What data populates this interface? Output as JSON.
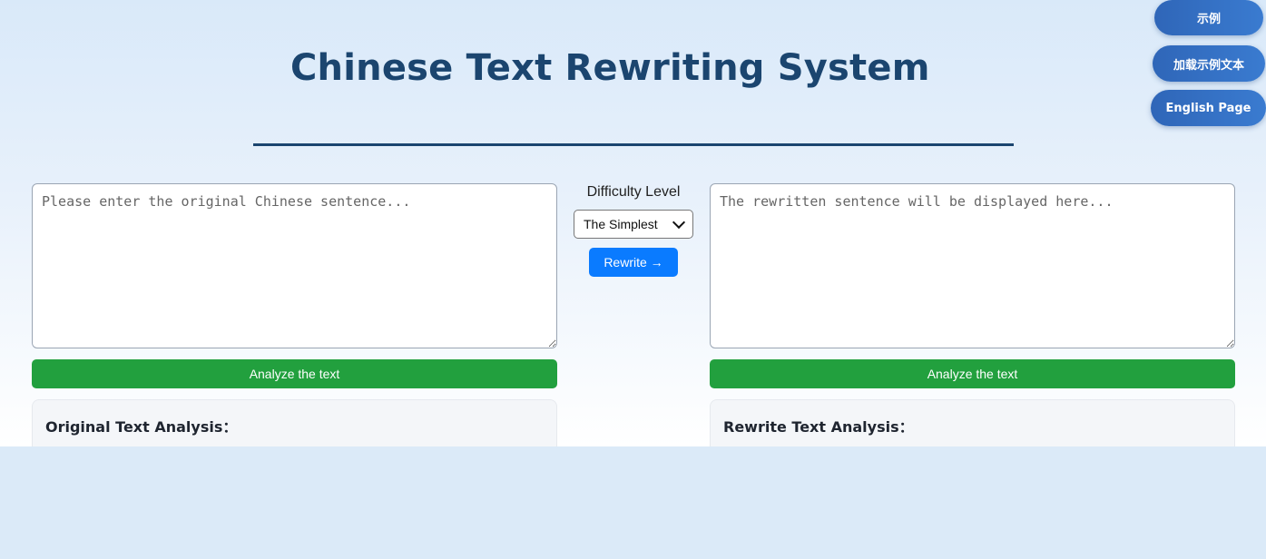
{
  "header": {
    "title": "Chinese Text Rewriting System"
  },
  "corner_buttons": {
    "example": "示例",
    "load_example": "加载示例文本",
    "english_page": "English Page"
  },
  "original": {
    "placeholder": "Please enter the original Chinese sentence...",
    "analyze_label": "Analyze the text",
    "analysis_title": "Original Text Analysis："
  },
  "controls": {
    "difficulty_label": "Difficulty Level",
    "difficulty_selected": "The Simplest",
    "rewrite_label": "Rewrite →"
  },
  "rewrite": {
    "placeholder": "The rewritten sentence will be displayed here...",
    "analyze_label": "Analyze the text",
    "analysis_title": "Rewrite Text Analysis："
  },
  "colors": {
    "title": "#1b456f",
    "rewrite_button": "#0a7bff",
    "analyze_button": "#22a03e",
    "corner_button": "#2f66b8"
  }
}
